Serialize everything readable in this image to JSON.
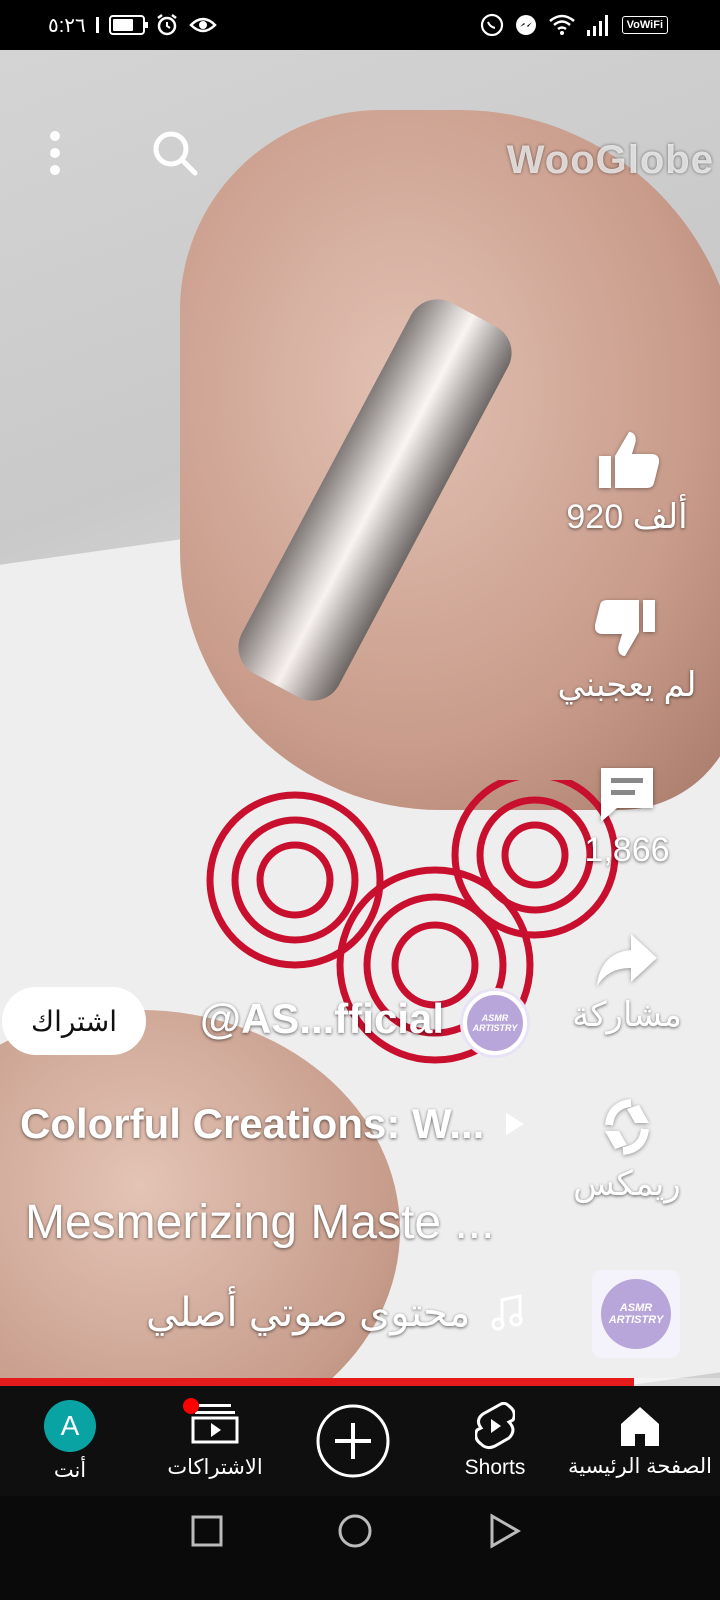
{
  "status_bar": {
    "time": "٥:٢٦",
    "icons": [
      "sim-icon",
      "battery-icon",
      "alarm-icon",
      "eye-icon",
      "whatsapp-icon",
      "messenger-icon",
      "wifi-icon",
      "signal-icon"
    ],
    "vowifi_label": "VoWiFi",
    "battery_level": 0.75
  },
  "video": {
    "watermark": "WooGlobe",
    "top_icons": [
      "more-vert-icon",
      "search-icon"
    ]
  },
  "actions": {
    "like_count": "920 ألف",
    "dislike_label": "لم يعجبني",
    "comments_count": "1,866",
    "share_label": "مشاركة",
    "remix_label": "ريمكس"
  },
  "channel": {
    "handle": "@AS...fficial",
    "subscribe_label": "اشتراك",
    "avatar_text": "ASMR ARTISTRY"
  },
  "playlist_title": "Colorful Creations: W...",
  "video_title": "Mesmerizing Maste ...",
  "audio": {
    "label": "محتوى صوتي أصلي",
    "thumb_text": "ASMR ARTISTRY"
  },
  "progress": 0.88,
  "bottom_nav": {
    "you": "أنت",
    "you_initial": "A",
    "subscriptions": "الاشتراكات",
    "shorts": "Shorts",
    "home": "الصفحة الرئيسية"
  },
  "colors": {
    "accent_red": "#e31b1b",
    "avatar_teal": "#0aa3a3"
  }
}
